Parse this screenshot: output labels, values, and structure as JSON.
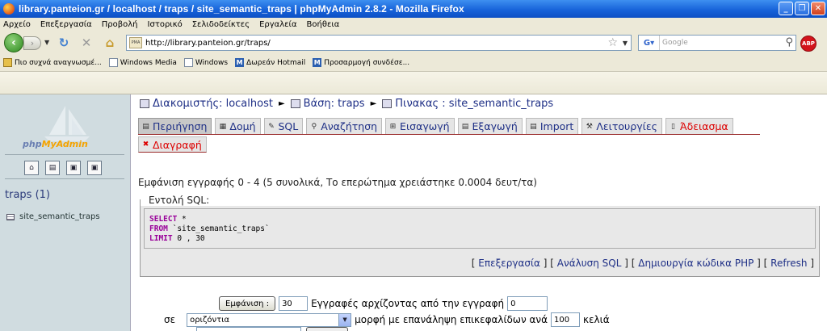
{
  "window": {
    "title": "library.panteion.gr / localhost / traps / site_semantic_traps | phpMyAdmin 2.8.2 - Mozilla Firefox",
    "buttons": [
      "_",
      "❐",
      "✕"
    ]
  },
  "menu": [
    "Αρχείο",
    "Επεξεργασία",
    "Προβολή",
    "Ιστορικό",
    "Σελιδοδείκτες",
    "Εργαλεία",
    "Βοήθεια"
  ],
  "toolbar": {
    "url": "http://library.panteion.gr/traps/",
    "search_placeholder": "Google",
    "abp_label": "ABP"
  },
  "bookmarks": [
    {
      "label": "Πιο συχνά αναγνωσμέ...",
      "icon": "folder-icon"
    },
    {
      "label": "Windows Media",
      "icon": "page-icon"
    },
    {
      "label": "Windows",
      "icon": "page-icon"
    },
    {
      "label": "Δωρεάν Hotmail",
      "icon": "msn-icon"
    },
    {
      "label": "Προσαρμογή συνδέσε...",
      "icon": "msn-icon"
    }
  ],
  "sidebar": {
    "logo": {
      "php": "php",
      "myadmin": "MyAdmin"
    },
    "database": "traps (1)",
    "tables": [
      "site_semantic_traps"
    ]
  },
  "breadcrumb": {
    "server": "Διακομιστής: localhost",
    "database": "Βάση: traps",
    "table": "Πινακας : site_semantic_traps"
  },
  "tabs": [
    {
      "label": "Περιήγηση",
      "icon": "browse-icon",
      "active": true
    },
    {
      "label": "Δομή",
      "icon": "structure-icon"
    },
    {
      "label": "SQL",
      "icon": "sql-icon"
    },
    {
      "label": "Αναζήτηση",
      "icon": "search-icon"
    },
    {
      "label": "Εισαγωγή",
      "icon": "insert-icon"
    },
    {
      "label": "Εξαγωγή",
      "icon": "export-icon"
    },
    {
      "label": "Import",
      "icon": "import-icon"
    },
    {
      "label": "Λειτουργίες",
      "icon": "operations-icon"
    },
    {
      "label": "Άδειασμα",
      "icon": "empty-icon",
      "danger": true
    },
    {
      "label": "Διαγραφή",
      "icon": "drop-icon",
      "danger": true
    }
  ],
  "result_info": "Εμφάνιση εγγραφής 0 - 4 (5 συνολικά, Το επερώτημα χρειάστηκε 0.0004 δευτ/τα)",
  "sql": {
    "legend": "Εντολή SQL:",
    "lines": [
      {
        "kw": "SELECT",
        "rest": " *"
      },
      {
        "kw": "FROM",
        "rest": " `site_semantic_traps`"
      },
      {
        "kw": "LIMIT",
        "rest": " 0 , 30"
      }
    ],
    "links": [
      "Επεξεργασία",
      "Ανάλυση SQL",
      "Δημιουργία κώδικα PHP",
      "Refresh"
    ]
  },
  "navigation": {
    "show_button": "Εμφάνιση :",
    "rows_value": "30",
    "rows_text": "Εγγραφές αρχίζοντας από την εγγραφή",
    "start_value": "0",
    "in_label": "σε",
    "mode_value": "οριζόντια",
    "repeat_text": "μορφή με επανάληψη επικεφαλίδων ανά",
    "repeat_value": "100",
    "cells_label": "κελιά"
  }
}
